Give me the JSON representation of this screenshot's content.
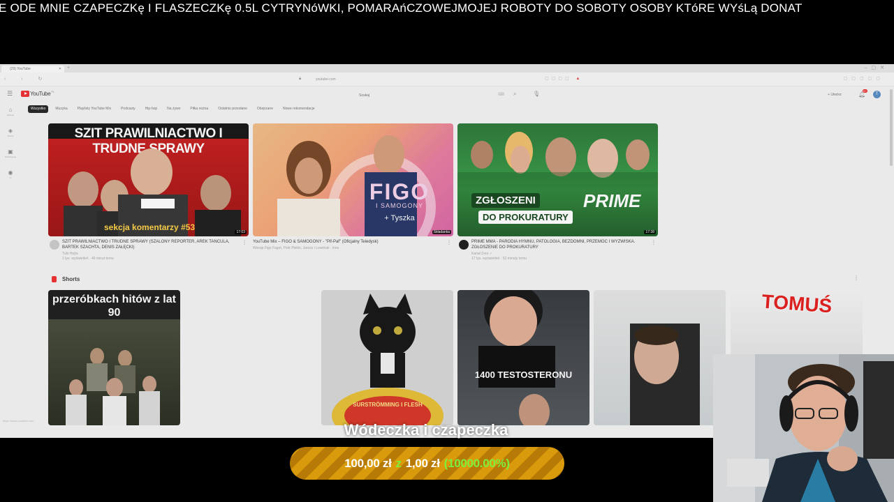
{
  "ticker": {
    "text": "E ODE MNIE CZAPECZKę I FLASZECZKę 0.5L CYTRYNóWKI, POMARAńCZOWEJMOJEJ ROBOTY DO SOBOTY OSOBY KTóRE WYśLą DONAT"
  },
  "browser": {
    "tab_title": "(29) YouTube",
    "url": "youtube.com"
  },
  "youtube": {
    "logo_text": "YouTube",
    "logo_country": "PL",
    "search_placeholder": "Szukaj",
    "create_label": "Utwórz",
    "notif_count": "9+",
    "avatar_letter": "T",
    "sidebar": [
      {
        "label": "Główna",
        "icon": "home-icon"
      },
      {
        "label": "Shorts",
        "icon": "shorts-icon"
      },
      {
        "label": "Subskrypcje",
        "icon": "subscriptions-icon"
      },
      {
        "label": "Ty",
        "icon": "user-icon"
      }
    ],
    "chips": [
      "Wszystko",
      "Muzyka",
      "Playlisty YouTube Mix",
      "Podcasty",
      "Hip-hop",
      "Na żywo",
      "Piłka nożna",
      "Ostatnio przesłane",
      "Obejrzane",
      "Nowe rekomendacje"
    ],
    "videos": [
      {
        "thumb_title": "SZIT PRAWILNIACTWO I TRUDNE SPRAWY",
        "thumb_caption": "sekcja komentarzy #53",
        "duration": "17:03",
        "title": "SZIT PRAWILNIACTWO I TRUDNE SPRAWY (SZALONY REPORTER, AREK TANCULA, BARTEK SZACHTA, DENIS ZAŁĘCKI)",
        "channel": "Tulo Hejta",
        "stats": "2 tys. wyświetleń · 46 minut temu"
      },
      {
        "thumb_title": "FIGO",
        "thumb_caption": "I SAMOGONY",
        "thumb_sub": "+ Tyszka",
        "duration": "Składanka",
        "title": "YouTube Mix – FIGO & SAMOGONY - \"Pif-Paf\" (Oficjalny Teledysk)",
        "channel": "Wersja Figo Fagot, Piotr Piekło, Jarosz i Lewiński · inne",
        "stats": ""
      },
      {
        "thumb_title": "PRIME",
        "thumb_caption": "ZGŁOSZENI",
        "thumb_sub": "DO PROKURATURY",
        "duration": "17:38",
        "title": "PRIME MMA - PARODIA HYMNU, PATOLOGIA, BEZDOMNI, PRZEMOC I WYZWISKA. ZGŁOSZENIE DO PROKURATURY",
        "channel": "Kanał Zero ✓",
        "stats": "17 tys. wyświetleń · 52 minuty temu"
      }
    ],
    "shorts_label": "Shorts",
    "shorts": [
      {
        "text": "przeróbkach hitów z lat 90"
      },
      {
        "text": "SURSTRÖMMING I FLESH"
      },
      {
        "text": "1400 TESTOSTERONU"
      },
      {
        "text": ""
      },
      {
        "text": "TOMUŚ"
      }
    ],
    "status_url": "https://www.youtube.com"
  },
  "donation_goal": {
    "title": "Wódeczka i czapeczka",
    "current": "100,00 zł",
    "separator": "z",
    "target": "1,00 zł",
    "percent": "(10000.00%)",
    "progress_fraction": 1.0
  },
  "colors": {
    "yt_red": "#e33333",
    "goal_gold": "#d99a0b",
    "goal_green": "#7ef03c"
  }
}
